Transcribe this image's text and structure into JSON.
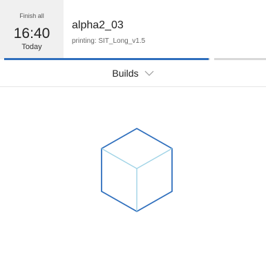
{
  "finish": {
    "label": "Finish all",
    "time": "16:40",
    "day": "Today"
  },
  "job": {
    "name": "alpha2_03",
    "status": "printing: SIT_Long_v1.5"
  },
  "progress": {
    "fraction": 0.78
  },
  "builds": {
    "label": "Builds"
  },
  "icons": {
    "dropdown": "chevron-down-icon",
    "placeholder": "cube-icon"
  },
  "colors": {
    "accent": "#2f6fbd",
    "cube_outline": "#2f6fbd",
    "cube_inner": "#9fd3e6"
  }
}
